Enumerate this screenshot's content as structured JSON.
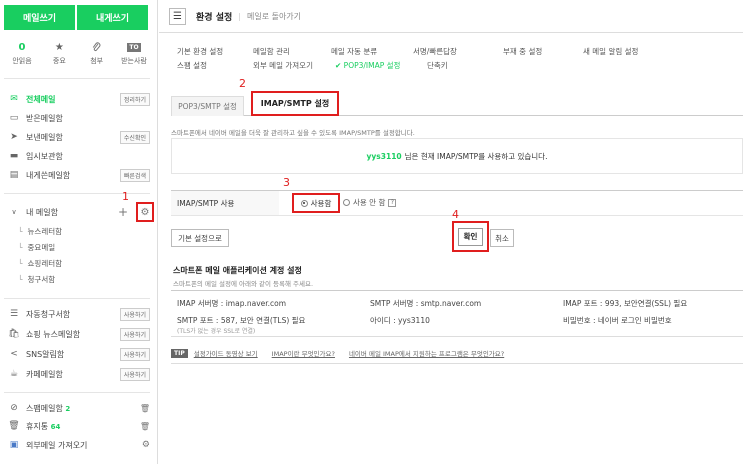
{
  "sidebar": {
    "write_button": "메일쓰기",
    "self_write_button": "내게쓰기",
    "quick": [
      {
        "value": "0",
        "label": "안읽음",
        "icon": "count"
      },
      {
        "value": "★",
        "label": "중요",
        "icon": "star-icon"
      },
      {
        "value": "📎",
        "label": "첨부",
        "icon": "attachment-icon"
      },
      {
        "value": "TO",
        "label": "받는사람",
        "icon": "to-icon"
      }
    ],
    "folders": [
      {
        "label": "전체메일",
        "badge": "정리하기",
        "icon": "inbox-icon",
        "active": true
      },
      {
        "label": "받은메일함",
        "badge": "",
        "icon": "receive-icon"
      },
      {
        "label": "보낸메일함",
        "badge": "수신확인",
        "icon": "send-icon"
      },
      {
        "label": "임시보관함",
        "badge": "",
        "icon": "draft-icon"
      },
      {
        "label": "내게쓴메일함",
        "badge": "빠른검색",
        "icon": "self-icon"
      }
    ],
    "my_mailbox": {
      "label": "내 메일함",
      "add": "+",
      "gear": "⚙",
      "items": [
        "뉴스레터함",
        "중요메일",
        "쇼핑레터함",
        "청구서함"
      ]
    },
    "services": [
      {
        "label": "자동청구서함",
        "badge": "사용하기",
        "icon": "bill-icon"
      },
      {
        "label": "쇼핑 뉴스메일함",
        "badge": "사용하기",
        "icon": "shopping-icon"
      },
      {
        "label": "SNS알림함",
        "badge": "사용하기",
        "icon": "share-icon"
      },
      {
        "label": "카페메일함",
        "badge": "사용하기",
        "icon": "cafe-icon"
      }
    ],
    "bottom": [
      {
        "label": "스팸메일함",
        "count": "2",
        "icon": "spam-icon",
        "right": "🗑"
      },
      {
        "label": "휴지통",
        "count": "64",
        "icon": "trash-icon",
        "right": "🗑"
      },
      {
        "label": "외부메일 가져오기",
        "count": "",
        "icon": "external-icon",
        "right": "⚙"
      }
    ]
  },
  "header": {
    "title": "환경 설정",
    "back_link": "메일로 돌아가기"
  },
  "settings_links": [
    "기본 환경 설정",
    "메일함 관리",
    "메일 자동 분류",
    "서명/빠른답장",
    "부재 중 설정",
    "새 메일 알림 설정",
    "스팸 설정",
    "외부 메일 가져오기",
    "✔ POP3/IMAP 설정",
    "단축키"
  ],
  "tabs": {
    "pop3": "POP3/SMTP 설정",
    "imap": "IMAP/SMTP 설정"
  },
  "description": "스마트폰에서 네이버 메일을 더욱 잘 관리하고 싶을 수 있도록 IMAP/SMTP를 설정합니다.",
  "notice": {
    "user_id": "yys3110",
    "text": "님은 현재 IMAP/SMTP를 사용하고 있습니다."
  },
  "usage": {
    "label": "IMAP/SMTP 사용",
    "on": "사용함",
    "off": "사용 안 함",
    "help": "?"
  },
  "buttons": {
    "default": "기본 설정으로",
    "confirm": "확인",
    "cancel": "취소"
  },
  "account": {
    "title": "스마트폰 메일 애플리케이션 계정 설정",
    "desc": "스마트폰의 메일 설정에 아래와 같이 등록해 주세요.",
    "imap_server": "IMAP 서버명 : imap.naver.com",
    "smtp_server": "SMTP 서버명 : smtp.naver.com",
    "imap_port": "IMAP 포트 : 993, 보안연결(SSL) 필요",
    "smtp_port": "SMTP 포트 : 587, 보안 연결(TLS) 필요",
    "smtp_note": "(TLS가 없는 경우 SSL로 연결)",
    "user_id": "아이디 : yys3110",
    "password": "비밀번호 : 네이버 로그인 비밀번호"
  },
  "tip": {
    "badge": "TIP",
    "links": [
      "설정가이드 동영상 보기",
      "IMAP이란 무엇인가요?",
      "네이버 메일 IMAP에서 지원하는 프로그램은 무엇인가요?"
    ]
  },
  "annotations": [
    "1",
    "2",
    "3",
    "4"
  ],
  "colors": {
    "accent": "#19ce60",
    "highlight": "#e01e1e"
  }
}
